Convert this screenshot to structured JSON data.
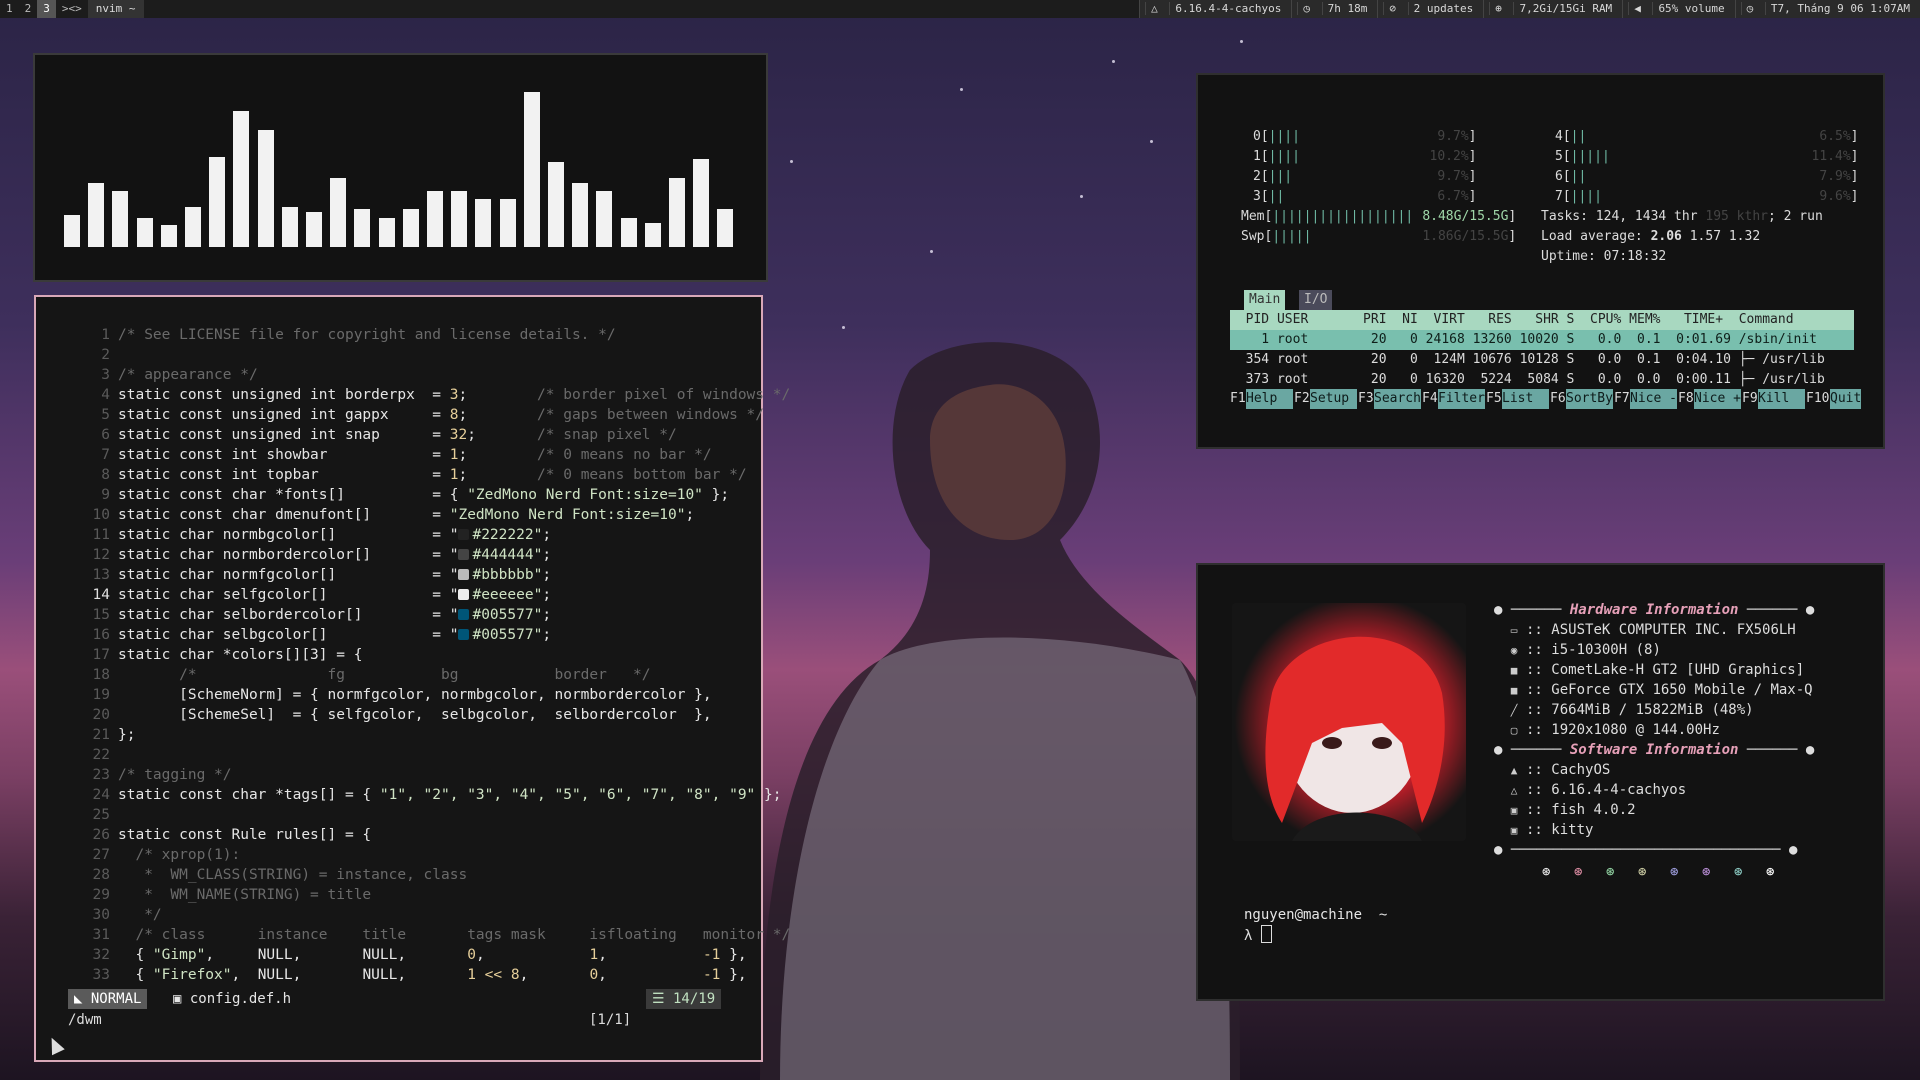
{
  "topbar": {
    "tags": [
      "1",
      "2",
      "3"
    ],
    "active_tag": "3",
    "layout": "><>",
    "title": "nvim ~",
    "kernel": "6.16.4-4-cachyos",
    "uptime": "7h 18m",
    "updates": "2 updates",
    "ram": "7,2Gi/15Gi RAM",
    "volume": "65% volume",
    "clock": "T7, Tháng 9 06 1:07AM"
  },
  "visualizer": {
    "values": [
      0.2,
      0.4,
      0.35,
      0.18,
      0.14,
      0.25,
      0.56,
      0.85,
      0.73,
      0.25,
      0.22,
      0.43,
      0.24,
      0.18,
      0.24,
      0.35,
      0.35,
      0.3,
      0.3,
      0.97,
      0.53,
      0.4,
      0.35,
      0.18,
      0.15,
      0.43,
      0.55,
      0.24
    ]
  },
  "nvim": {
    "lines": [
      {
        "n": "1",
        "parts": [
          [
            "c-com",
            "/* See LICENSE file for copyright and license details. */"
          ]
        ]
      },
      {
        "n": "2",
        "parts": []
      },
      {
        "n": "3",
        "parts": [
          [
            "c-com",
            "/* appearance */"
          ]
        ]
      },
      {
        "n": "4",
        "parts": [
          [
            "code",
            "static const unsigned int borderpx  = "
          ],
          [
            "c-num",
            "3"
          ],
          [
            "code",
            ";        "
          ],
          [
            "c-com",
            "/* border pixel of windows */"
          ]
        ]
      },
      {
        "n": "5",
        "parts": [
          [
            "code",
            "static const unsigned int gappx     = "
          ],
          [
            "c-num",
            "8"
          ],
          [
            "code",
            ";        "
          ],
          [
            "c-com",
            "/* gaps between windows */"
          ]
        ]
      },
      {
        "n": "6",
        "parts": [
          [
            "code",
            "static const unsigned int snap      = "
          ],
          [
            "c-num",
            "32"
          ],
          [
            "code",
            ";       "
          ],
          [
            "c-com",
            "/* snap pixel */"
          ]
        ]
      },
      {
        "n": "7",
        "parts": [
          [
            "code",
            "static const int showbar            = "
          ],
          [
            "c-num",
            "1"
          ],
          [
            "code",
            ";        "
          ],
          [
            "c-com",
            "/* 0 means no bar */"
          ]
        ]
      },
      {
        "n": "8",
        "parts": [
          [
            "code",
            "static const int topbar             = "
          ],
          [
            "c-num",
            "1"
          ],
          [
            "code",
            ";        "
          ],
          [
            "c-com",
            "/* 0 means bottom bar */"
          ]
        ]
      },
      {
        "n": "9",
        "parts": [
          [
            "code",
            "static const char *fonts[]          = { "
          ],
          [
            "c-str",
            "\"ZedMono Nerd Font:size=10\""
          ],
          [
            "code",
            " };"
          ]
        ]
      },
      {
        "n": "10",
        "parts": [
          [
            "code",
            "static const char dmenufont[]       = "
          ],
          [
            "c-str",
            "\"ZedMono Nerd Font:size=10\""
          ],
          [
            "code",
            ";"
          ]
        ]
      },
      {
        "n": "11",
        "parts": [
          [
            "code",
            "static char normbgcolor[]           = \""
          ],
          [
            "sw",
            "#222222"
          ],
          [
            "c-str",
            "#222222\""
          ],
          [
            "code",
            ";"
          ]
        ]
      },
      {
        "n": "12",
        "parts": [
          [
            "code",
            "static char normbordercolor[]       = \""
          ],
          [
            "sw",
            "#444444"
          ],
          [
            "c-str",
            "#444444\""
          ],
          [
            "code",
            ";"
          ]
        ]
      },
      {
        "n": "13",
        "parts": [
          [
            "code",
            "static char normfgcolor[]           = \""
          ],
          [
            "sw",
            "#bbbbbb"
          ],
          [
            "c-str",
            "#bbbbbb\""
          ],
          [
            "code",
            ";"
          ]
        ]
      },
      {
        "n": "14",
        "parts": [
          [
            "code",
            "static char selfgcolor[]            = \""
          ],
          [
            "sw",
            "#eeeeee"
          ],
          [
            "c-str",
            "#eeeeee\""
          ],
          [
            "code",
            ";"
          ]
        ]
      },
      {
        "n": "15",
        "parts": [
          [
            "code",
            "static char selbordercolor[]        = \""
          ],
          [
            "sw",
            "#005577"
          ],
          [
            "c-str",
            "#005577\""
          ],
          [
            "code",
            ";"
          ]
        ]
      },
      {
        "n": "16",
        "parts": [
          [
            "code",
            "static char selbgcolor[]            = \""
          ],
          [
            "sw",
            "#005577"
          ],
          [
            "c-str",
            "#005577\""
          ],
          [
            "code",
            ";"
          ]
        ]
      },
      {
        "n": "17",
        "parts": [
          [
            "code",
            "static char *colors[][3] = {"
          ]
        ]
      },
      {
        "n": "18",
        "parts": [
          [
            "c-com",
            "       /*               fg           bg           border   */"
          ]
        ]
      },
      {
        "n": "19",
        "parts": [
          [
            "code",
            "       [SchemeNorm] = { normfgcolor, normbgcolor, normbordercolor },"
          ]
        ]
      },
      {
        "n": "20",
        "parts": [
          [
            "code",
            "       [SchemeSel]  = { selfgcolor,  selbgcolor,  selbordercolor  },"
          ]
        ]
      },
      {
        "n": "21",
        "parts": [
          [
            "code",
            "};"
          ]
        ]
      },
      {
        "n": "22",
        "parts": []
      },
      {
        "n": "23",
        "parts": [
          [
            "c-com",
            "/* tagging */"
          ]
        ]
      },
      {
        "n": "24",
        "parts": [
          [
            "code",
            "static const char *tags[] = { "
          ],
          [
            "c-str",
            "\"1\", \"2\", \"3\", \"4\", \"5\", \"6\", \"7\", \"8\", \"9\""
          ],
          [
            "code",
            " };"
          ]
        ]
      },
      {
        "n": "25",
        "parts": []
      },
      {
        "n": "26",
        "parts": [
          [
            "code",
            "static const Rule rules[] = {"
          ]
        ]
      },
      {
        "n": "27",
        "parts": [
          [
            "c-com",
            "  /* xprop(1):"
          ]
        ]
      },
      {
        "n": "28",
        "parts": [
          [
            "c-com",
            "   *  WM_CLASS(STRING) = instance, class"
          ]
        ]
      },
      {
        "n": "29",
        "parts": [
          [
            "c-com",
            "   *  WM_NAME(STRING) = title"
          ]
        ]
      },
      {
        "n": "30",
        "parts": [
          [
            "c-com",
            "   */"
          ]
        ]
      },
      {
        "n": "31",
        "parts": [
          [
            "c-com",
            "  /* class      instance    title       tags mask     isfloating   monitor */"
          ]
        ]
      },
      {
        "n": "32",
        "parts": [
          [
            "code",
            "  { "
          ],
          [
            "c-str",
            "\"Gimp\""
          ],
          [
            "code",
            ",     NULL,       NULL,       "
          ],
          [
            "c-num",
            "0"
          ],
          [
            "code",
            ",            "
          ],
          [
            "c-num",
            "1"
          ],
          [
            "code",
            ",           "
          ],
          [
            "c-num",
            "-1"
          ],
          [
            "code",
            " },"
          ]
        ]
      },
      {
        "n": "33",
        "parts": [
          [
            "code",
            "  { "
          ],
          [
            "c-str",
            "\"Firefox\""
          ],
          [
            "code",
            ",  NULL,       NULL,       "
          ],
          [
            "c-num",
            "1 << 8"
          ],
          [
            "code",
            ",       "
          ],
          [
            "c-num",
            "0"
          ],
          [
            "code",
            ",           "
          ],
          [
            "c-num",
            "-1"
          ],
          [
            "code",
            " },"
          ]
        ]
      }
    ],
    "current_line": "14",
    "mode": "NORMAL",
    "filename": "config.def.h",
    "position": "14/19",
    "cmdline": "/dwm",
    "search_count": "[1/1]"
  },
  "htop": {
    "cpus_left": [
      {
        "id": "0",
        "bars": "||||",
        "val": "9.7%"
      },
      {
        "id": "1",
        "bars": "||||",
        "val": "10.2%"
      },
      {
        "id": "2",
        "bars": "|||",
        "val": "9.7%"
      },
      {
        "id": "3",
        "bars": "||",
        "val": "6.7%"
      }
    ],
    "cpus_right": [
      {
        "id": "4",
        "bars": "||",
        "val": "6.5%"
      },
      {
        "id": "5",
        "bars": "|||||",
        "val": "11.4%"
      },
      {
        "id": "6",
        "bars": "||",
        "val": "7.9%"
      },
      {
        "id": "7",
        "bars": "||||",
        "val": "9.6%"
      }
    ],
    "mem_bars": "||||||||||||||||||",
    "mem_val": "8.48G/15.5G",
    "swp_bars": "|||||",
    "swp_val": "1.86G/15.5G",
    "tasks": "Tasks: 124, 1434 thr",
    "kthr": " 195 kthr",
    "running": "; 2 run",
    "load_label": "Load average: ",
    "load1": "2.06",
    "load_rest": " 1.57 1.32",
    "uptime": "Uptime: 07:18:32",
    "tabs": [
      "Main",
      "I/O"
    ],
    "header": "  PID USER       PRI  NI  VIRT   RES   SHR S  CPU% MEM%   TIME+  Command",
    "rows": [
      "    1 root        20   0 24168 13260 10020 S   0.0  0.1  0:01.69 /sbin/init",
      "  354 root        20   0  124M 10676 10128 S   0.0  0.1  0:04.10 ├─ /usr/lib",
      "  373 root        20   0 16320  5224  5084 S   0.0  0.0  0:00.11 ├─ /usr/lib"
    ],
    "fkeys": [
      {
        "k": "F1",
        "v": "Help  "
      },
      {
        "k": "F2",
        "v": "Setup "
      },
      {
        "k": "F3",
        "v": "Search"
      },
      {
        "k": "F4",
        "v": "Filter"
      },
      {
        "k": "F5",
        "v": "List  "
      },
      {
        "k": "F6",
        "v": "SortBy"
      },
      {
        "k": "F7",
        "v": "Nice -"
      },
      {
        "k": "F8",
        "v": "Nice +"
      },
      {
        "k": "F9",
        "v": "Kill  "
      },
      {
        "k": "F10",
        "v": "Quit"
      }
    ]
  },
  "fastfetch": {
    "hw_title": "Hardware Information",
    "hw": [
      {
        "icon": "laptop-icon",
        "glyph": "▭",
        "text": "ASUSTeK COMPUTER INC. FX506LH"
      },
      {
        "icon": "cpu-icon",
        "glyph": "◉",
        "text": "i5-10300H (8)"
      },
      {
        "icon": "gpu-icon",
        "glyph": "■",
        "text": "CometLake-H GT2 [UHD Graphics]"
      },
      {
        "icon": "gpu-icon",
        "glyph": "■",
        "text": "GeForce GTX 1650 Mobile / Max-Q"
      },
      {
        "icon": "memory-icon",
        "glyph": "╱",
        "text": "7664MiB / 15822MiB (48%)"
      },
      {
        "icon": "monitor-icon",
        "glyph": "▢",
        "text": "1920x1080 @ 144.00Hz"
      }
    ],
    "sw_title": "Software Information",
    "sw": [
      {
        "icon": "os-icon",
        "glyph": "▲",
        "text": "CachyOS"
      },
      {
        "icon": "kernel-icon",
        "glyph": "△",
        "text": "6.16.4-4-cachyos"
      },
      {
        "icon": "shell-icon",
        "glyph": "▣",
        "text": "fish 4.0.2"
      },
      {
        "icon": "terminal-icon",
        "glyph": "▣",
        "text": "kitty"
      }
    ],
    "palette": [
      "#e6e6e6",
      "#d98aa0",
      "#8fd0a0",
      "#c8c8a0",
      "#9a9ad8",
      "#b48ad0",
      "#8ac8c0",
      "#ffffff"
    ],
    "prompt_user": "nguyen@machine",
    "prompt_path": "~",
    "prompt_char": "λ"
  }
}
